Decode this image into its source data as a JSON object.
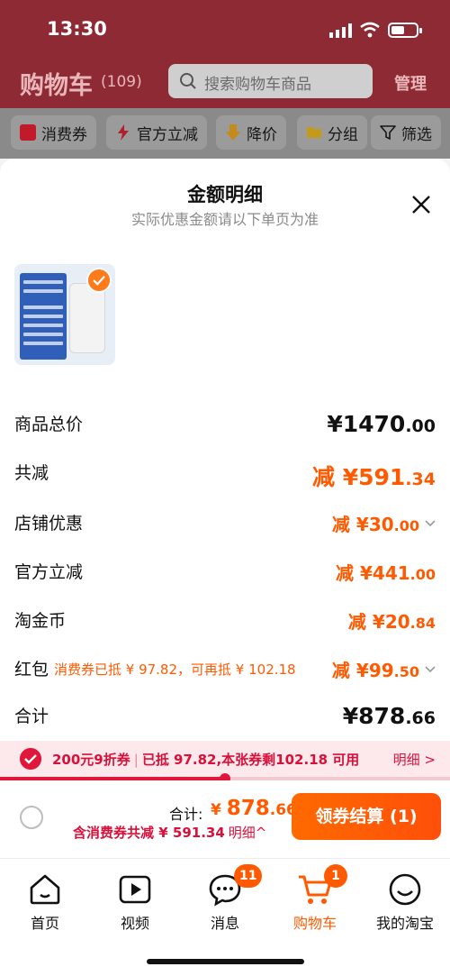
{
  "status": {
    "time": "13:30"
  },
  "header": {
    "title": "购物车",
    "count": "(109)",
    "search_placeholder": "搜索购物车商品",
    "manage": "管理"
  },
  "filters": [
    "消费券",
    "官方立减",
    "降价",
    "分组",
    "筛选"
  ],
  "sheet": {
    "title": "金额明细",
    "subtitle": "实际优惠金额请以下单页为准",
    "rows": {
      "goods_total": {
        "label": "商品总价",
        "prefix": "¥",
        "int": "1470",
        "dec": ".00"
      },
      "total_saved": {
        "label": "共减",
        "prefix": "减 ¥",
        "int": "591",
        "dec": ".34"
      },
      "shop_discount": {
        "label": "店铺优惠",
        "prefix": "减 ¥",
        "int": "30",
        "dec": ".00"
      },
      "official_discount": {
        "label": "官方立减",
        "prefix": "减 ¥",
        "int": "441",
        "dec": ".00"
      },
      "taojinbi": {
        "label": "淘金币",
        "prefix": "减 ¥",
        "int": "20",
        "dec": ".84"
      },
      "red_packet": {
        "label": "红包",
        "note": "消费券已抵 ¥ 97.82，可再抵 ¥ 102.18",
        "prefix": "减 ¥",
        "int": "99",
        "dec": ".50"
      },
      "sum": {
        "label": "合计",
        "prefix": "¥",
        "int": "878",
        "dec": ".66"
      }
    }
  },
  "coupon_bar": {
    "coupon": "200元9折券",
    "detail": "已抵 97.82,本张券剩102.18 可用",
    "link": "明细 >",
    "progress": 0.5
  },
  "checkout": {
    "total_label": "合计:",
    "currency": "¥ ",
    "total_int": "878",
    "total_dec": ".66",
    "saved": "含消费券共减 ¥ 591.34",
    "detail_link": "明细^",
    "button": "领券结算 (1)"
  },
  "tabs": [
    {
      "label": "首页",
      "icon": "home-icon"
    },
    {
      "label": "视频",
      "icon": "video-icon"
    },
    {
      "label": "消息",
      "icon": "message-icon",
      "badge": "11"
    },
    {
      "label": "购物车",
      "icon": "cart-icon",
      "badge": "1"
    },
    {
      "label": "我的淘宝",
      "icon": "profile-icon"
    }
  ],
  "colors": {
    "accent": "#ff5a00",
    "brand_red": "#e0163a"
  }
}
